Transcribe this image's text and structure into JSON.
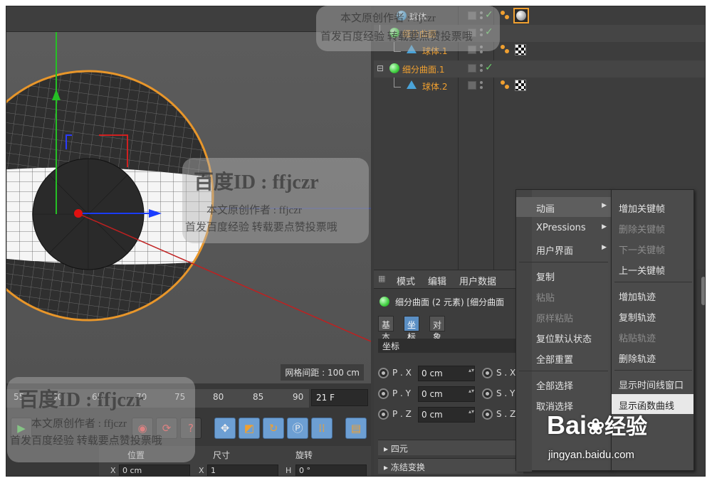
{
  "viewport": {
    "grid_spacing": "网格间距 : 100 cm"
  },
  "object_manager": {
    "rows": [
      {
        "name": "球体",
        "color": "white",
        "icon": "sphere-icon",
        "tags": "check",
        "material": "sphere-material"
      },
      {
        "name": "细分曲面",
        "color": "orange",
        "icon": "subdivision-icon",
        "tags": "check",
        "material": ""
      },
      {
        "name": "球体.1",
        "color": "orange",
        "icon": "sphere-child-icon",
        "tags": "",
        "material": "checker-material"
      },
      {
        "name": "细分曲面.1",
        "color": "orange",
        "icon": "subdivision-icon",
        "tags": "check",
        "material": ""
      },
      {
        "name": "球体.2",
        "color": "orange",
        "icon": "sphere-child-icon",
        "tags": "",
        "material": "checker-material"
      }
    ],
    "colors": {
      "orange": "#f0a030",
      "white": "#e8e8e8"
    }
  },
  "attribute_manager": {
    "menu": [
      "模式",
      "编辑",
      "用户数据"
    ],
    "title": "细分曲面 (2 元素) [细分曲面",
    "tabs": [
      "基本",
      "坐标",
      "对象"
    ],
    "active_tab": "坐标",
    "section": "坐标",
    "coords": [
      {
        "label": "P . X",
        "value": "0 cm",
        "scale_label": "S . X"
      },
      {
        "label": "P . Y",
        "value": "0 cm",
        "scale_label": "S . Y"
      },
      {
        "label": "P . Z",
        "value": "0 cm",
        "scale_label": "S . Z"
      }
    ],
    "folds": [
      "▸ 四元",
      "▸ 冻结变换"
    ]
  },
  "timeline": {
    "ruler": [
      "55",
      "60",
      "65",
      "70",
      "75",
      "80",
      "85",
      "90"
    ],
    "frame": "21 F",
    "bottom_headers": [
      "位置",
      "尺寸",
      "旋转"
    ],
    "bottom_fields": [
      {
        "label": "X",
        "value": "0 cm"
      },
      {
        "label": "X",
        "value": "1"
      },
      {
        "label": "H",
        "value": "0 °"
      }
    ]
  },
  "context_menu": {
    "items": [
      {
        "label": "动画",
        "submenu": true,
        "disabled": false,
        "highlight": true
      },
      {
        "label": "XPressions",
        "submenu": true,
        "disabled": false
      },
      {
        "label": "用户界面",
        "submenu": true,
        "disabled": false
      },
      {
        "label": "复制",
        "disabled": false
      },
      {
        "label": "粘贴",
        "disabled": true
      },
      {
        "label": "原样粘贴",
        "disabled": true
      },
      {
        "label": "复位默认状态",
        "disabled": false
      },
      {
        "label": "全部重置",
        "disabled": false
      },
      {
        "label": "全部选择",
        "disabled": false
      },
      {
        "label": "取消选择",
        "disabled": false
      }
    ],
    "submenu_items": [
      {
        "label": "增加关键帧",
        "disabled": false
      },
      {
        "label": "删除关键帧",
        "disabled": true
      },
      {
        "label": "下一关键帧",
        "disabled": true
      },
      {
        "label": "上一关键帧",
        "disabled": false
      },
      {
        "label": "增加轨迹",
        "disabled": false
      },
      {
        "label": "复制轨迹",
        "disabled": false
      },
      {
        "label": "粘贴轨迹",
        "disabled": true
      },
      {
        "label": "删除轨迹",
        "disabled": false
      },
      {
        "label": "显示时间线窗口",
        "disabled": false
      },
      {
        "label": "显示函数曲线",
        "disabled": false,
        "selected": true
      }
    ]
  },
  "watermarks": {
    "id_text": "百度ID : ffjczr",
    "author": "本文原创作者 : ffjczr",
    "notice": "首发百度经验  转载要点赞投票哦",
    "baidu_logo": "Bai",
    "baidu_jingyan": "经验",
    "baidu_url": "jingyan.baidu.com"
  }
}
